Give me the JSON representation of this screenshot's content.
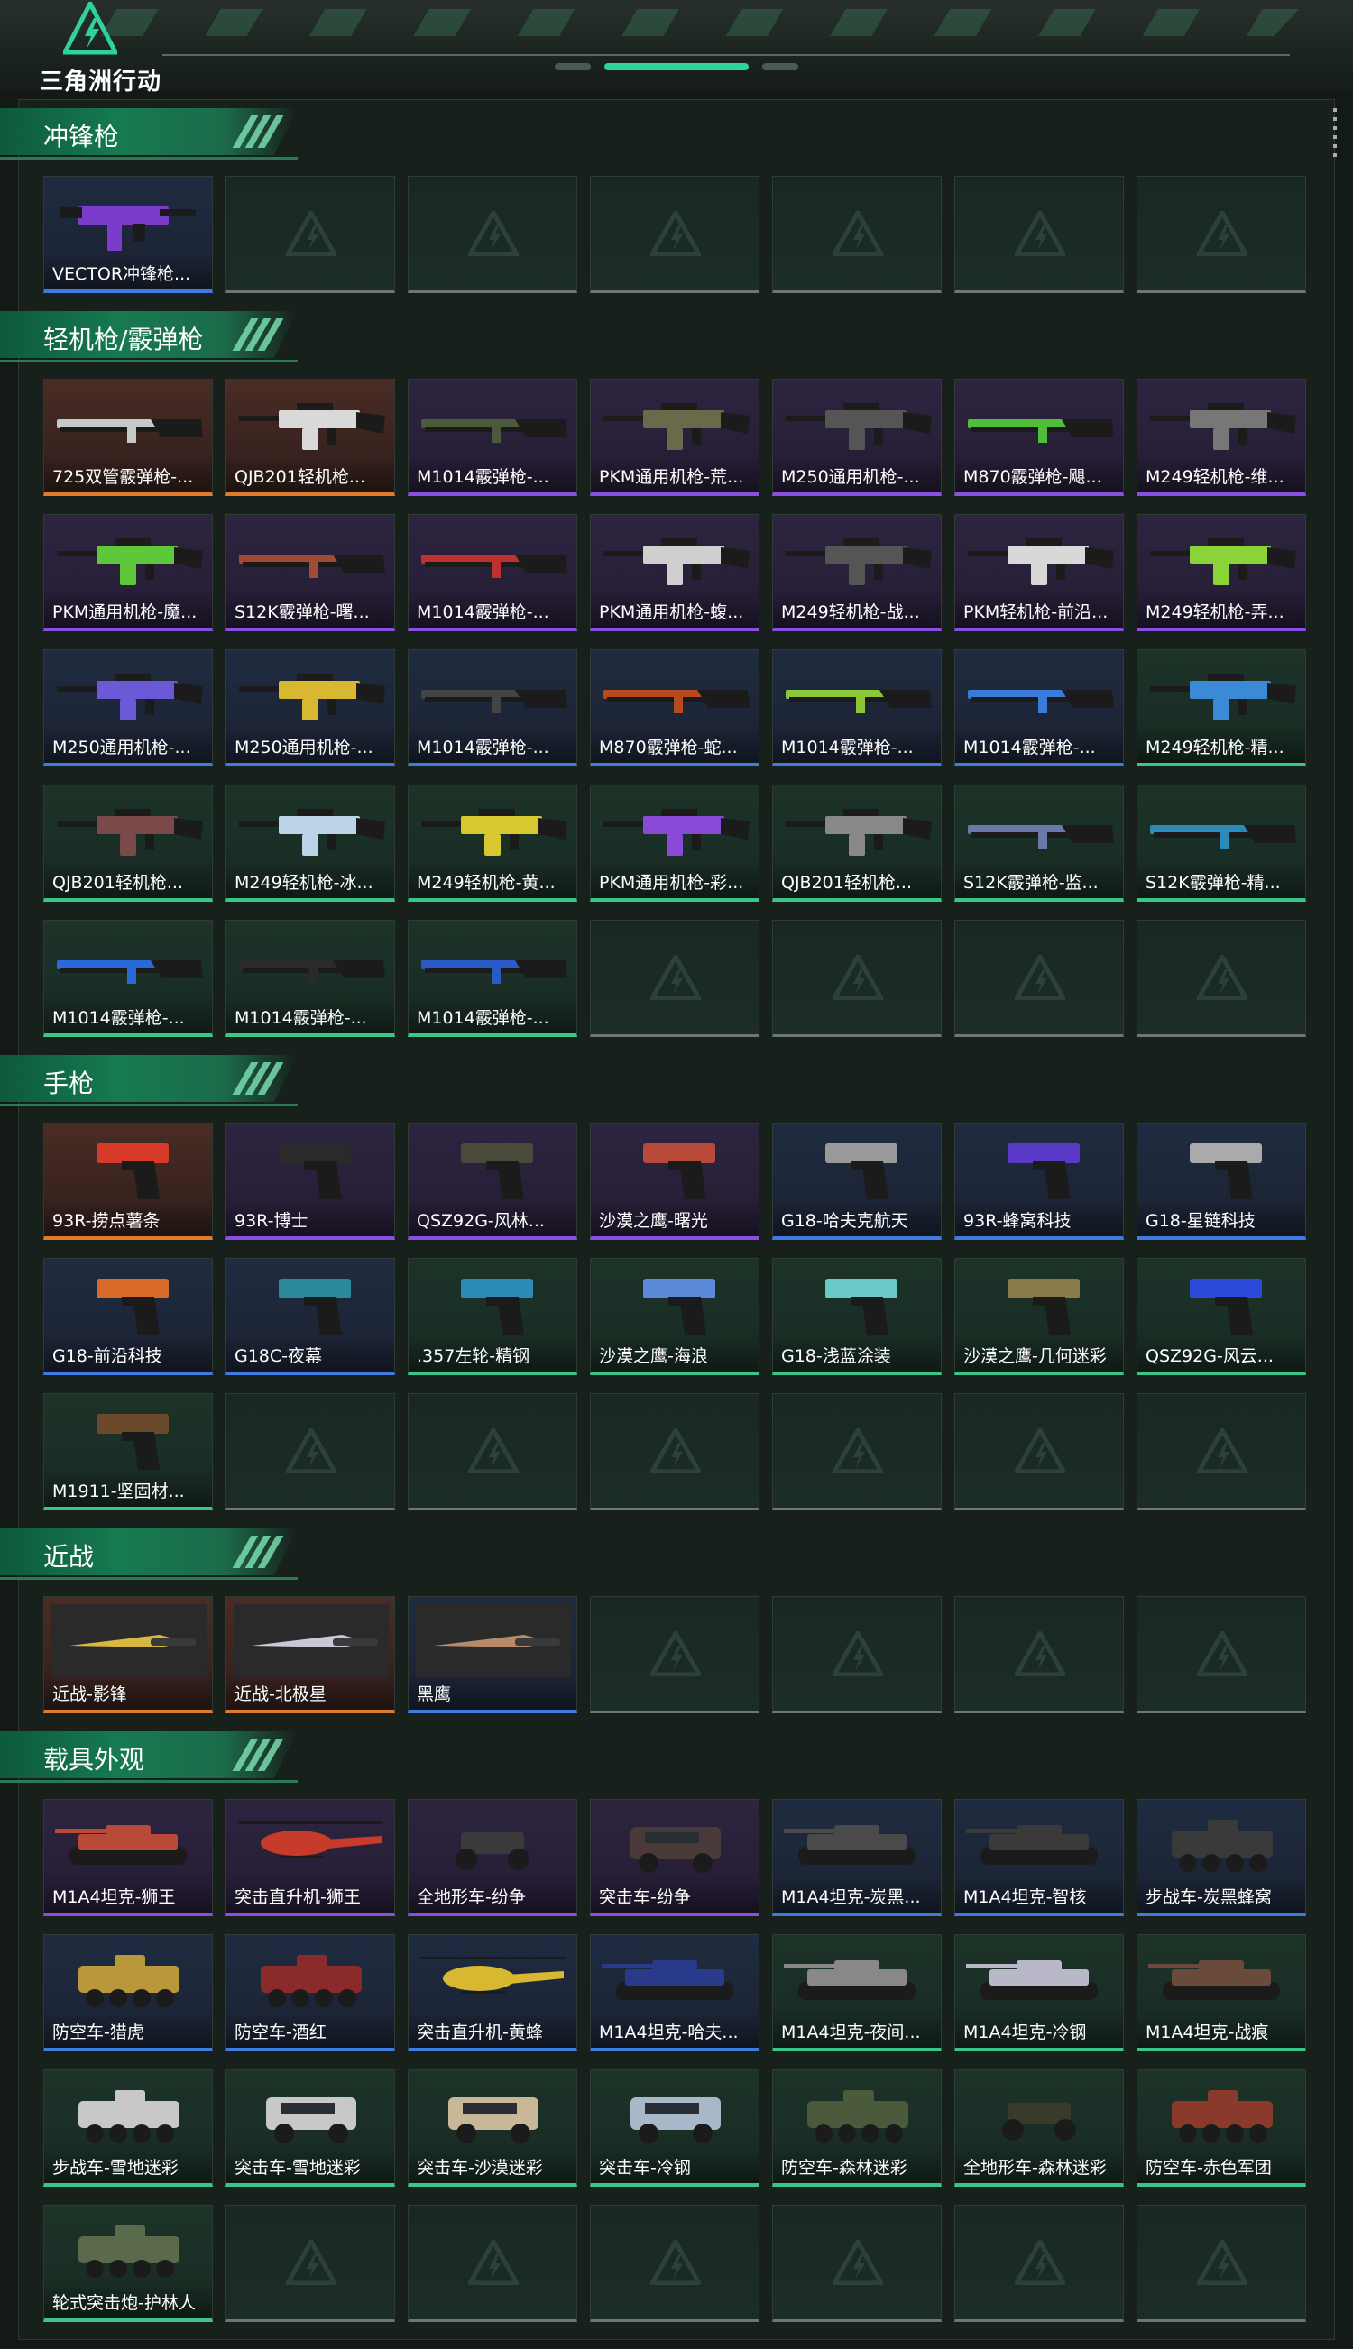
{
  "header": {
    "game_logo_text": "三角洲行动"
  },
  "sections": [
    {
      "title": "冲锋枪",
      "items": [
        {
          "label": "VECTOR冲锋枪...",
          "rarity": "blue",
          "kind": "smg",
          "color": "#7a3cc9"
        }
      ]
    },
    {
      "title": "轻机枪/霰弹枪",
      "items": [
        {
          "label": "725双管霰弹枪-...",
          "rarity": "orange",
          "kind": "shotgun",
          "color": "#c8c8c8"
        },
        {
          "label": "QJB201轻机枪...",
          "rarity": "orange",
          "kind": "lmg",
          "color": "#d9d9d9"
        },
        {
          "label": "M1014霰弹枪-...",
          "rarity": "purple",
          "kind": "shotgun",
          "color": "#4a5a3a"
        },
        {
          "label": "PKM通用机枪-荒...",
          "rarity": "purple",
          "kind": "lmg",
          "color": "#6a6a4a"
        },
        {
          "label": "M250通用机枪-...",
          "rarity": "purple",
          "kind": "lmg",
          "color": "#555555"
        },
        {
          "label": "M870霰弹枪-飓...",
          "rarity": "purple",
          "kind": "shotgun",
          "color": "#4fbf3a"
        },
        {
          "label": "M249轻机枪-维...",
          "rarity": "purple",
          "kind": "lmg",
          "color": "#777777"
        },
        {
          "label": "PKM通用机枪-魔...",
          "rarity": "purple",
          "kind": "lmg",
          "color": "#5cc83a"
        },
        {
          "label": "S12K霰弹枪-曙...",
          "rarity": "purple",
          "kind": "shotgun",
          "color": "#a04a3a"
        },
        {
          "label": "M1014霰弹枪-...",
          "rarity": "purple",
          "kind": "shotgun",
          "color": "#c03030"
        },
        {
          "label": "PKM通用机枪-蝮...",
          "rarity": "purple",
          "kind": "lmg",
          "color": "#cfcfcf"
        },
        {
          "label": "M249轻机枪-战...",
          "rarity": "purple",
          "kind": "lmg",
          "color": "#555555"
        },
        {
          "label": "PKM轻机枪-前沿...",
          "rarity": "purple",
          "kind": "lmg",
          "color": "#d8d8d8"
        },
        {
          "label": "M249轻机枪-弄...",
          "rarity": "purple",
          "kind": "lmg",
          "color": "#8ad43a"
        },
        {
          "label": "M250通用机枪-...",
          "rarity": "blue",
          "kind": "lmg",
          "color": "#6a5ad8"
        },
        {
          "label": "M250通用机枪-...",
          "rarity": "blue",
          "kind": "lmg",
          "color": "#d8b830"
        },
        {
          "label": "M1014霰弹枪-...",
          "rarity": "blue",
          "kind": "shotgun",
          "color": "#444444"
        },
        {
          "label": "M870霰弹枪-蛇...",
          "rarity": "blue",
          "kind": "shotgun",
          "color": "#b84a20"
        },
        {
          "label": "M1014霰弹枪-...",
          "rarity": "blue",
          "kind": "shotgun",
          "color": "#8ac83a"
        },
        {
          "label": "M1014霰弹枪-...",
          "rarity": "blue",
          "kind": "shotgun",
          "color": "#3a7ad8"
        },
        {
          "label": "M249轻机枪-精...",
          "rarity": "green",
          "kind": "lmg",
          "color": "#3a8ad8"
        },
        {
          "label": "QJB201轻机枪...",
          "rarity": "green",
          "kind": "lmg",
          "color": "#7a4a4a"
        },
        {
          "label": "M249轻机枪-冰...",
          "rarity": "green",
          "kind": "lmg",
          "color": "#bcd4e8"
        },
        {
          "label": "M249轻机枪-黄...",
          "rarity": "green",
          "kind": "lmg",
          "color": "#d8c830"
        },
        {
          "label": "PKM通用机枪-彩...",
          "rarity": "green",
          "kind": "lmg",
          "color": "#8a4ad8"
        },
        {
          "label": "QJB201轻机枪...",
          "rarity": "green",
          "kind": "lmg",
          "color": "#888888"
        },
        {
          "label": "S12K霰弹枪-监...",
          "rarity": "green",
          "kind": "shotgun",
          "color": "#6a7aa8"
        },
        {
          "label": "S12K霰弹枪-精...",
          "rarity": "green",
          "kind": "shotgun",
          "color": "#2a8ab8"
        },
        {
          "label": "M1014霰弹枪-...",
          "rarity": "green",
          "kind": "shotgun",
          "color": "#2a6ad8"
        },
        {
          "label": "M1014霰弹枪-...",
          "rarity": "green",
          "kind": "shotgun",
          "color": "#2a2a2a"
        },
        {
          "label": "M1014霰弹枪-...",
          "rarity": "green",
          "kind": "shotgun",
          "color": "#2a5ac8"
        }
      ]
    },
    {
      "title": "手枪",
      "items": [
        {
          "label": "93R-捞点薯条",
          "rarity": "orange",
          "kind": "pistol",
          "color": "#d83a2a"
        },
        {
          "label": "93R-博士",
          "rarity": "purple",
          "kind": "pistol",
          "color": "#2a2a2a"
        },
        {
          "label": "QSZ92G-风林...",
          "rarity": "purple",
          "kind": "pistol",
          "color": "#4a4a3a"
        },
        {
          "label": "沙漠之鹰-曙光",
          "rarity": "purple",
          "kind": "pistol",
          "color": "#b84a3a"
        },
        {
          "label": "G18-哈夫克航天",
          "rarity": "blue",
          "kind": "pistol",
          "color": "#9a9a9a"
        },
        {
          "label": "93R-蜂窝科技",
          "rarity": "blue",
          "kind": "pistol",
          "color": "#5a3ac8"
        },
        {
          "label": "G18-星链科技",
          "rarity": "blue",
          "kind": "pistol",
          "color": "#aaaaaa"
        },
        {
          "label": "G18-前沿科技",
          "rarity": "blue",
          "kind": "pistol",
          "color": "#d86a2a"
        },
        {
          "label": "G18C-夜幕",
          "rarity": "blue",
          "kind": "pistol",
          "color": "#2a8a9a"
        },
        {
          "label": ".357左轮-精钢",
          "rarity": "green",
          "kind": "pistol",
          "color": "#2a8ab8"
        },
        {
          "label": "沙漠之鹰-海浪",
          "rarity": "green",
          "kind": "pistol",
          "color": "#5a8ad8"
        },
        {
          "label": "G18-浅蓝涂装",
          "rarity": "green",
          "kind": "pistol",
          "color": "#6ac8c8"
        },
        {
          "label": "沙漠之鹰-几何迷彩",
          "rarity": "green",
          "kind": "pistol",
          "color": "#8a7a4a"
        },
        {
          "label": "QSZ92G-风云...",
          "rarity": "green",
          "kind": "pistol",
          "color": "#2a4ad8"
        },
        {
          "label": "M1911-坚固材...",
          "rarity": "green",
          "kind": "pistol",
          "color": "#6a4a2a"
        }
      ]
    },
    {
      "title": "近战",
      "items": [
        {
          "label": "近战-影锋",
          "rarity": "orange",
          "kind": "knife",
          "color": "#d8b840"
        },
        {
          "label": "近战-北极星",
          "rarity": "orange",
          "kind": "knife",
          "color": "#c8c8d8"
        },
        {
          "label": "黑鹰",
          "rarity": "blue",
          "kind": "knife",
          "color": "#b88a6a"
        }
      ]
    },
    {
      "title": "载具外观",
      "items": [
        {
          "label": "M1A4坦克-狮王",
          "rarity": "purple",
          "kind": "tank",
          "color": "#b84a3a"
        },
        {
          "label": "突击直升机-狮王",
          "rarity": "purple",
          "kind": "heli",
          "color": "#c83a2a"
        },
        {
          "label": "全地形车-纷争",
          "rarity": "purple",
          "kind": "atv",
          "color": "#3a3a3a"
        },
        {
          "label": "突击车-纷争",
          "rarity": "purple",
          "kind": "car",
          "color": "#4a3a3a"
        },
        {
          "label": "M1A4坦克-炭黑...",
          "rarity": "blue",
          "kind": "tank",
          "color": "#4a4a4a"
        },
        {
          "label": "M1A4坦克-智核",
          "rarity": "blue",
          "kind": "tank",
          "color": "#3a3a3a"
        },
        {
          "label": "步战车-炭黑蜂窝",
          "rarity": "blue",
          "kind": "apc",
          "color": "#3a3a3a"
        },
        {
          "label": "防空车-猎虎",
          "rarity": "blue",
          "kind": "apc",
          "color": "#b8983a"
        },
        {
          "label": "防空车-酒红",
          "rarity": "blue",
          "kind": "apc",
          "color": "#8a2a2a"
        },
        {
          "label": "突击直升机-黄蜂",
          "rarity": "blue",
          "kind": "heli",
          "color": "#d8b830"
        },
        {
          "label": "M1A4坦克-哈夫...",
          "rarity": "blue",
          "kind": "tank",
          "color": "#2a3a8a"
        },
        {
          "label": "M1A4坦克-夜间...",
          "rarity": "green",
          "kind": "tank",
          "color": "#888888"
        },
        {
          "label": "M1A4坦克-冷钢",
          "rarity": "green",
          "kind": "tank",
          "color": "#b8b8c8"
        },
        {
          "label": "M1A4坦克-战痕",
          "rarity": "green",
          "kind": "tank",
          "color": "#6a4a3a"
        },
        {
          "label": "步战车-雪地迷彩",
          "rarity": "green",
          "kind": "apc",
          "color": "#c8c8c8"
        },
        {
          "label": "突击车-雪地迷彩",
          "rarity": "green",
          "kind": "car",
          "color": "#c8c8c8"
        },
        {
          "label": "突击车-沙漠迷彩",
          "rarity": "green",
          "kind": "car",
          "color": "#c8b898"
        },
        {
          "label": "突击车-冷钢",
          "rarity": "green",
          "kind": "car",
          "color": "#a8b8c8"
        },
        {
          "label": "防空车-森林迷彩",
          "rarity": "green",
          "kind": "apc",
          "color": "#4a5a3a"
        },
        {
          "label": "全地形车-森林迷彩",
          "rarity": "green",
          "kind": "atv",
          "color": "#3a3a2a"
        },
        {
          "label": "防空车-赤色军团",
          "rarity": "green",
          "kind": "apc",
          "color": "#8a3a2a"
        },
        {
          "label": "轮式突击炮-护林人",
          "rarity": "green",
          "kind": "apc",
          "color": "#5a6a4a"
        }
      ]
    }
  ],
  "colors": {
    "orange": "#e07b2a",
    "purple": "#8a4fe0",
    "blue": "#3f7be0",
    "green": "#39c688",
    "accent": "#2fd39a"
  }
}
